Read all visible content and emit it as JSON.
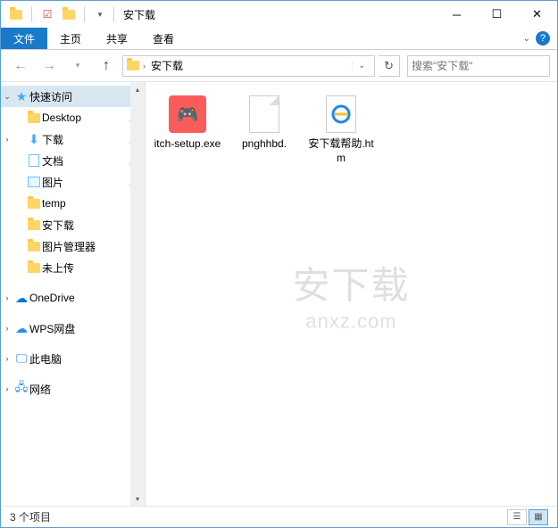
{
  "titlebar": {
    "title": "安下载"
  },
  "ribbon": {
    "file": "文件",
    "tabs": [
      "主页",
      "共享",
      "查看"
    ]
  },
  "nav": {
    "crumb": "安下载",
    "search_placeholder": "搜索\"安下载\""
  },
  "sidebar": {
    "quick": "快速访问",
    "items": [
      {
        "label": "Desktop",
        "icon": "desktop",
        "pinned": true
      },
      {
        "label": "下载",
        "icon": "download",
        "pinned": true
      },
      {
        "label": "文档",
        "icon": "doc",
        "pinned": true
      },
      {
        "label": "图片",
        "icon": "pic",
        "pinned": true
      },
      {
        "label": "temp",
        "icon": "folder",
        "pinned": false
      },
      {
        "label": "安下载",
        "icon": "folder",
        "pinned": false
      },
      {
        "label": "图片管理器",
        "icon": "folder",
        "pinned": false
      },
      {
        "label": "未上传",
        "icon": "folder",
        "pinned": false
      }
    ],
    "onedrive": "OneDrive",
    "wps": "WPS网盘",
    "thispc": "此电脑",
    "network": "网络"
  },
  "files": [
    {
      "name": "itch-setup.exe",
      "type": "itch"
    },
    {
      "name": "pnghhbd.",
      "type": "blank"
    },
    {
      "name": "安下载帮助.htm",
      "type": "ie"
    }
  ],
  "watermark": {
    "line1": "安下载",
    "line2": "anxz.com"
  },
  "status": {
    "count": "3 个项目"
  }
}
